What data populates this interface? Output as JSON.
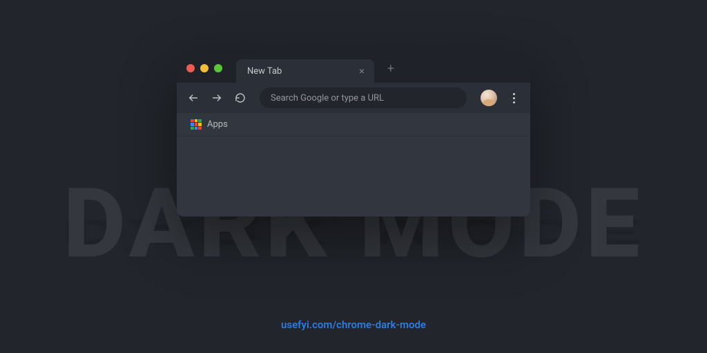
{
  "background": {
    "watermark_text": "DARK MODE"
  },
  "browser": {
    "window_controls": {
      "close": "close",
      "minimize": "minimize",
      "maximize": "maximize"
    },
    "tabs": [
      {
        "title": "New Tab",
        "active": true
      }
    ],
    "new_tab_label": "+",
    "toolbar": {
      "back_label": "Back",
      "forward_label": "Forward",
      "reload_label": "Reload",
      "omnibox_placeholder": "Search Google or type a URL",
      "profile_label": "Profile",
      "menu_label": "Menu"
    },
    "bookmarks_bar": {
      "apps_label": "Apps"
    }
  },
  "footer": {
    "url": "usefyi.com/chrome-dark-mode"
  },
  "colors": {
    "page_bg": "#22252b",
    "tabstrip_bg": "#1f2228",
    "chrome_bg": "#2b2f37",
    "content_bg": "#32363f",
    "accent_link": "#2a7de1"
  }
}
